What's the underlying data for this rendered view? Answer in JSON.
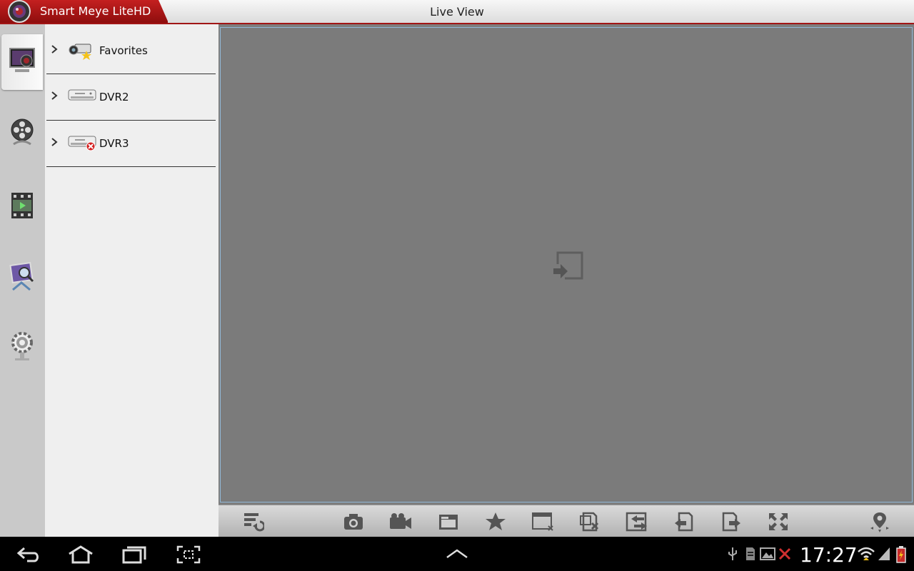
{
  "titlebar": {
    "app_name": "Smart Meye LiteHD",
    "page_title": "Live View"
  },
  "nav_rail": [
    {
      "name": "live-view",
      "icon": "camera-monitor-icon",
      "active": true
    },
    {
      "name": "playback",
      "icon": "film-reel-icon",
      "active": false
    },
    {
      "name": "recordings",
      "icon": "film-strip-icon",
      "active": false
    },
    {
      "name": "gallery",
      "icon": "photo-magnifier-icon",
      "active": false
    },
    {
      "name": "settings",
      "icon": "gear-icon",
      "active": false
    }
  ],
  "device_tree": [
    {
      "label": "Favorites",
      "icon": "camera-star-icon"
    },
    {
      "label": "DVR2",
      "icon": "dvr-icon"
    },
    {
      "label": "DVR3",
      "icon": "dvr-offline-icon"
    }
  ],
  "toolbar_icons": [
    "preset-refresh-icon",
    "snapshot-icon",
    "record-icon",
    "folder-icon",
    "star-icon",
    "close-window-icon",
    "delete-channel-icon",
    "swap-icon",
    "previous-page-icon",
    "next-page-icon",
    "fullscreen-icon",
    "ptz-icon"
  ],
  "system_bar": {
    "clock": "17:27"
  },
  "colors": {
    "accent_red": "#b31515",
    "video_border": "#92b9d8"
  }
}
